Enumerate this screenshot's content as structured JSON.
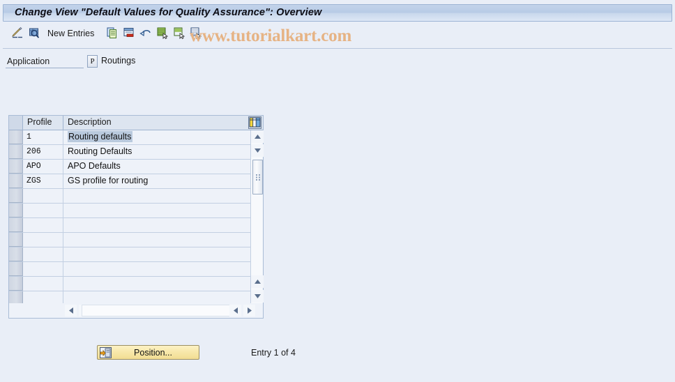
{
  "window": {
    "title": "Change View \"Default Values for Quality Assurance\": Overview"
  },
  "watermark": {
    "text": "www.tutorialkart.com",
    "color": "#e6b384"
  },
  "toolbar": {
    "items": [
      {
        "name": "display-change-icon",
        "icon": "pencil-glasses"
      },
      {
        "name": "check-entries-icon",
        "icon": "magnifier-table"
      },
      {
        "name": "new-entries-button",
        "label": "New Entries"
      },
      {
        "name": "copy-as-icon",
        "icon": "copy"
      },
      {
        "name": "delete-icon",
        "icon": "delete-row"
      },
      {
        "name": "undo-icon",
        "icon": "undo-arrow"
      },
      {
        "name": "select-all-icon",
        "icon": "select-all"
      },
      {
        "name": "select-block-icon",
        "icon": "select-block"
      },
      {
        "name": "deselect-all-icon",
        "icon": "deselect-all"
      }
    ],
    "new_entries_label": "New Entries"
  },
  "application_row": {
    "field_label": "Application",
    "field_value": "",
    "field_placeholder": "",
    "dropdown_label": "P",
    "routings_label": "Routings"
  },
  "table": {
    "columns": [
      "Profile",
      "Description"
    ],
    "config_icon": "table-settings-icon",
    "rows": [
      {
        "profile": "1",
        "description": "Routing defaults",
        "selected": true
      },
      {
        "profile": "206",
        "description": "Routing Defaults",
        "selected": false
      },
      {
        "profile": "APO",
        "description": "APO Defaults",
        "selected": false
      },
      {
        "profile": "ZGS",
        "description": "GS profile for routing",
        "selected": false
      },
      {
        "profile": "",
        "description": "",
        "selected": false
      },
      {
        "profile": "",
        "description": "",
        "selected": false
      },
      {
        "profile": "",
        "description": "",
        "selected": false
      },
      {
        "profile": "",
        "description": "",
        "selected": false
      },
      {
        "profile": "",
        "description": "",
        "selected": false
      },
      {
        "profile": "",
        "description": "",
        "selected": false
      },
      {
        "profile": "",
        "description": "",
        "selected": false
      },
      {
        "profile": "",
        "description": "",
        "selected": false
      }
    ]
  },
  "footer": {
    "position_button_label": "Position...",
    "entry_status": "Entry 1 of 4"
  }
}
